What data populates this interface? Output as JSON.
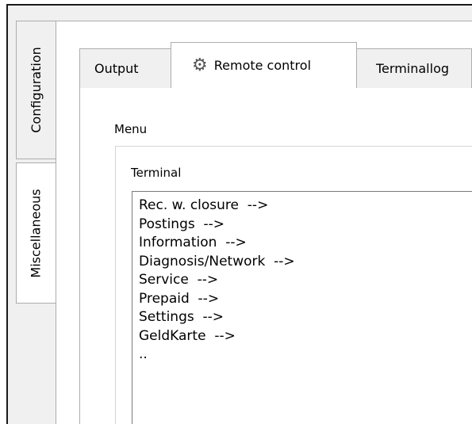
{
  "side_tabs": [
    {
      "label": "Configuration"
    },
    {
      "label": "Miscellaneous"
    }
  ],
  "tabs": [
    {
      "label": "Output"
    },
    {
      "label": "Remote control",
      "icon": "gears-icon"
    },
    {
      "label": "Terminallog"
    }
  ],
  "menu": {
    "label": "Menu",
    "terminal_label": "Terminal",
    "items": [
      "Rec. w. closure  -->",
      "Postings  -->",
      "Information  -->",
      "Diagnosis/Network  -->",
      "Service  -->",
      "Prepaid  -->",
      "Settings  -->",
      "GeldKarte  -->",
      ".."
    ]
  }
}
